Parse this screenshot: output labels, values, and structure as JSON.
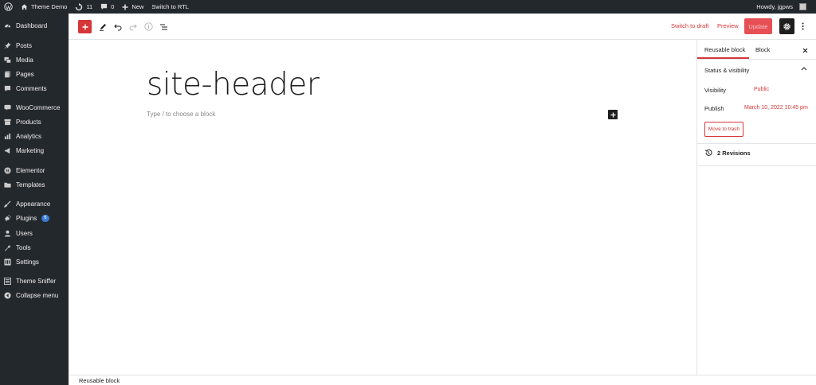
{
  "adminbar": {
    "site_name": "Theme Demo",
    "updates_count": "11",
    "comments_count": "0",
    "new_label": "New",
    "rtl_label": "Switch to RTL",
    "howdy": "Howdy, jgpws"
  },
  "sidebar": {
    "items": [
      {
        "label": "Dashboard",
        "icon": "dashboard-icon"
      },
      {
        "label": "Posts",
        "icon": "pin-icon"
      },
      {
        "label": "Media",
        "icon": "media-icon"
      },
      {
        "label": "Pages",
        "icon": "page-icon"
      },
      {
        "label": "Comments",
        "icon": "comment-icon"
      },
      {
        "label": "WooCommerce",
        "icon": "woocommerce-icon"
      },
      {
        "label": "Products",
        "icon": "archive-icon"
      },
      {
        "label": "Analytics",
        "icon": "chart-icon"
      },
      {
        "label": "Marketing",
        "icon": "megaphone-icon"
      },
      {
        "label": "Elementor",
        "icon": "elementor-icon"
      },
      {
        "label": "Templates",
        "icon": "folder-icon"
      },
      {
        "label": "Appearance",
        "icon": "brush-icon"
      },
      {
        "label": "Plugins",
        "icon": "plug-icon",
        "badge": "6"
      },
      {
        "label": "Users",
        "icon": "user-icon"
      },
      {
        "label": "Tools",
        "icon": "wrench-icon"
      },
      {
        "label": "Settings",
        "icon": "settings-icon"
      },
      {
        "label": "Theme Sniffer",
        "icon": "list-icon"
      },
      {
        "label": "Collapse menu",
        "icon": "collapse-icon"
      }
    ]
  },
  "toolbar": {
    "switch_to_draft": "Switch to draft",
    "preview": "Preview",
    "update": "Update"
  },
  "editor": {
    "title": "site-header",
    "placeholder": "Type / to choose a block"
  },
  "panel": {
    "tab_reusable": "Reusable block",
    "tab_block": "Block",
    "section_title": "Status & visibility",
    "visibility_label": "Visibility",
    "visibility_value": "Public",
    "publish_label": "Publish",
    "publish_value": "March 10, 2022 10:45 pm",
    "trash_label": "Move to trash",
    "revisions_label": "2 Revisions"
  },
  "footer": {
    "breadcrumb": "Reusable block"
  },
  "colors": {
    "accent": "#d63638",
    "admin_dark": "#23282d"
  }
}
